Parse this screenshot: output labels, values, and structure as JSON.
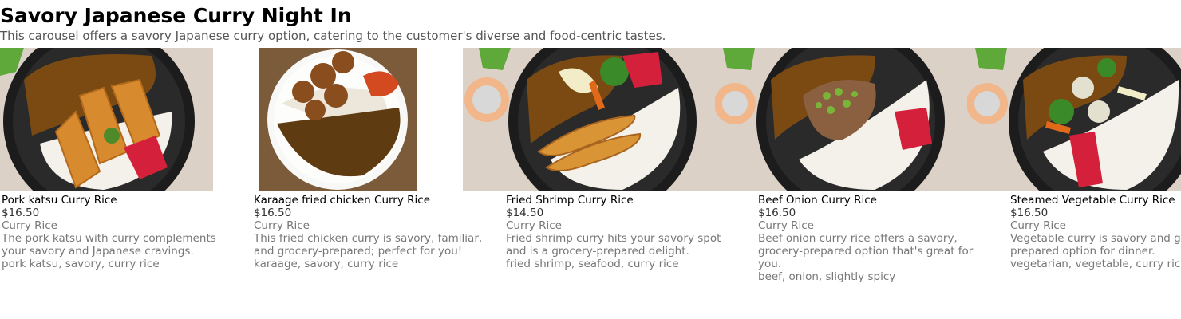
{
  "page": {
    "title": "Savory Japanese Curry Night In",
    "subtitle": "This carousel offers a savory Japanese curry option, catering to the customer's diverse and food-centric tastes."
  },
  "items": [
    {
      "name": "Pork katsu Curry Rice",
      "price": "$16.50",
      "category": "Curry Rice",
      "description": "The pork katsu with curry complements your savory and Japanese cravings.",
      "tags": "pork katsu, savory, curry rice"
    },
    {
      "name": "Karaage fried chicken Curry Rice",
      "price": "$16.50",
      "category": "Curry Rice",
      "description": "This fried chicken curry is savory, familiar, and grocery-prepared; perfect for you!",
      "tags": "karaage, savory, curry rice"
    },
    {
      "name": "Fried Shrimp Curry Rice",
      "price": "$14.50",
      "category": "Curry Rice",
      "description": "Fried shrimp curry hits your savory spot and is a grocery-prepared delight.",
      "tags": "fried shrimp, seafood, curry rice"
    },
    {
      "name": "Beef Onion Curry Rice",
      "price": "$16.50",
      "category": "Curry Rice",
      "description": "Beef onion curry rice offers a savory, grocery-prepared option that's great for you.",
      "tags": "beef, onion, slightly spicy"
    },
    {
      "name": "Steamed Vegetable Curry Rice",
      "price": "$16.50",
      "category": "Curry Rice",
      "description": "Vegetable curry is savory and grocery-prepared option for dinner.",
      "tags": "vegetarian, vegetable, curry rice"
    }
  ],
  "colors": {
    "curry": "#7a4a12",
    "rice": "#f4f1ea",
    "bowl": "#1c1c1c",
    "wood": "#8a5a36",
    "pickle": "#d4203a"
  }
}
